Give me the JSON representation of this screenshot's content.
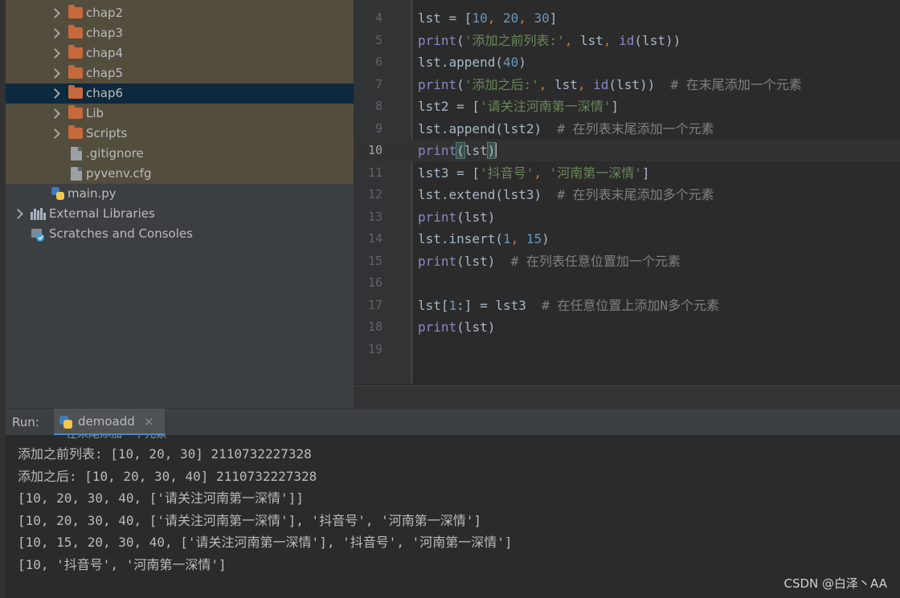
{
  "project_tree": {
    "items": [
      {
        "label": "chap2",
        "kind": "folder",
        "expanded": false,
        "selected": false
      },
      {
        "label": "chap3",
        "kind": "folder",
        "expanded": false,
        "selected": false
      },
      {
        "label": "chap4",
        "kind": "folder",
        "expanded": false,
        "selected": false
      },
      {
        "label": "chap5",
        "kind": "folder",
        "expanded": false,
        "selected": false
      },
      {
        "label": "chap6",
        "kind": "folder",
        "expanded": false,
        "selected": true
      },
      {
        "label": "Lib",
        "kind": "folder",
        "expanded": false,
        "selected": false
      },
      {
        "label": "Scripts",
        "kind": "folder",
        "expanded": false,
        "selected": false
      },
      {
        "label": ".gitignore",
        "kind": "file",
        "selected": false
      },
      {
        "label": "pyvenv.cfg",
        "kind": "file",
        "selected": false
      },
      {
        "label": "main.py",
        "kind": "python-file",
        "selected": false
      },
      {
        "label": "External Libraries",
        "kind": "libraries",
        "expanded": false,
        "selected": false
      },
      {
        "label": "Scratches and Consoles",
        "kind": "scratches",
        "selected": false
      }
    ]
  },
  "editor": {
    "current_line": "10",
    "lines": [
      {
        "num": "4",
        "tokens": [
          [
            "lst = [",
            "default"
          ],
          [
            "10",
            "number"
          ],
          [
            ", ",
            "punct"
          ],
          [
            "20",
            "number"
          ],
          [
            ", ",
            "punct"
          ],
          [
            "30",
            "number"
          ],
          [
            "]",
            "default"
          ]
        ]
      },
      {
        "num": "5",
        "tokens": [
          [
            "print",
            "builtin"
          ],
          [
            "(",
            "default"
          ],
          [
            "'添加之前列表:'",
            "string"
          ],
          [
            ", ",
            "punct"
          ],
          [
            "lst",
            "default"
          ],
          [
            ", ",
            "punct"
          ],
          [
            "id",
            "builtin"
          ],
          [
            "(lst))",
            "default"
          ]
        ]
      },
      {
        "num": "6",
        "tokens": [
          [
            "lst.append(",
            "default"
          ],
          [
            "40",
            "number"
          ],
          [
            ")",
            "default"
          ]
        ]
      },
      {
        "num": "7",
        "tokens": [
          [
            "print",
            "builtin"
          ],
          [
            "(",
            "default"
          ],
          [
            "'添加之后:'",
            "string"
          ],
          [
            ", ",
            "punct"
          ],
          [
            "lst",
            "default"
          ],
          [
            ", ",
            "punct"
          ],
          [
            "id",
            "builtin"
          ],
          [
            "(lst))  ",
            "default"
          ],
          [
            "# 在末尾添加一个元素",
            "comment"
          ]
        ]
      },
      {
        "num": "8",
        "tokens": [
          [
            "lst2 = [",
            "default"
          ],
          [
            "'请关注河南第一深情'",
            "string"
          ],
          [
            "]",
            "default"
          ]
        ]
      },
      {
        "num": "9",
        "tokens": [
          [
            "lst.append(lst2)  ",
            "default"
          ],
          [
            "# 在列表末尾添加一个元素",
            "comment"
          ]
        ]
      },
      {
        "num": "10",
        "tokens": [
          [
            "print",
            "builtin"
          ],
          [
            "(",
            "bracket"
          ],
          [
            "lst",
            "default"
          ],
          [
            ")",
            "bracket"
          ]
        ]
      },
      {
        "num": "11",
        "tokens": [
          [
            "lst3 = [",
            "default"
          ],
          [
            "'抖音号'",
            "string"
          ],
          [
            ", ",
            "punct"
          ],
          [
            "'河南第一深情'",
            "string"
          ],
          [
            "]",
            "default"
          ]
        ]
      },
      {
        "num": "12",
        "tokens": [
          [
            "lst.extend(lst3)  ",
            "default"
          ],
          [
            "# 在列表末尾添加多个元素",
            "comment"
          ]
        ]
      },
      {
        "num": "13",
        "tokens": [
          [
            "print",
            "builtin"
          ],
          [
            "(lst)",
            "default"
          ]
        ]
      },
      {
        "num": "14",
        "tokens": [
          [
            "lst.insert(",
            "default"
          ],
          [
            "1",
            "number"
          ],
          [
            ", ",
            "punct"
          ],
          [
            "15",
            "number"
          ],
          [
            ")",
            "default"
          ]
        ]
      },
      {
        "num": "15",
        "tokens": [
          [
            "print",
            "builtin"
          ],
          [
            "(lst)  ",
            "default"
          ],
          [
            "# 在列表任意位置加一个元素",
            "comment"
          ]
        ]
      },
      {
        "num": "16",
        "tokens": []
      },
      {
        "num": "17",
        "tokens": [
          [
            "lst[",
            "default"
          ],
          [
            "1",
            "number"
          ],
          [
            ":] = lst3  ",
            "default"
          ],
          [
            "# 在任意位置上添加N多个元素",
            "comment"
          ]
        ]
      },
      {
        "num": "18",
        "tokens": [
          [
            "print",
            "builtin"
          ],
          [
            "(lst)",
            "default"
          ]
        ]
      },
      {
        "num": "19",
        "tokens": []
      }
    ]
  },
  "run_panel": {
    "title": "Run:",
    "tab_label": "demoadd",
    "tab_close": "×",
    "partial_line": "在末尾添加一个元素",
    "output": [
      "添加之前列表: [10, 20, 30] 2110732227328",
      "添加之后: [10, 20, 30, 40] 2110732227328",
      "[10, 20, 30, 40, ['请关注河南第一深情']]",
      "[10, 20, 30, 40, ['请关注河南第一深情'], '抖音号', '河南第一深情']",
      "[10, 15, 20, 30, 40, ['请关注河南第一深情'], '抖音号', '河南第一深情']",
      "[10, '抖音号', '河南第一深情']"
    ]
  },
  "watermark": "CSDN @白泽丶AA",
  "colors": {
    "keyword_builtin": "#8888c6",
    "number": "#6897bb",
    "string": "#6a8759",
    "comment": "#808080",
    "punctuation": "#cc7832",
    "folder": "#c6693c",
    "selection": "#0d293e"
  }
}
